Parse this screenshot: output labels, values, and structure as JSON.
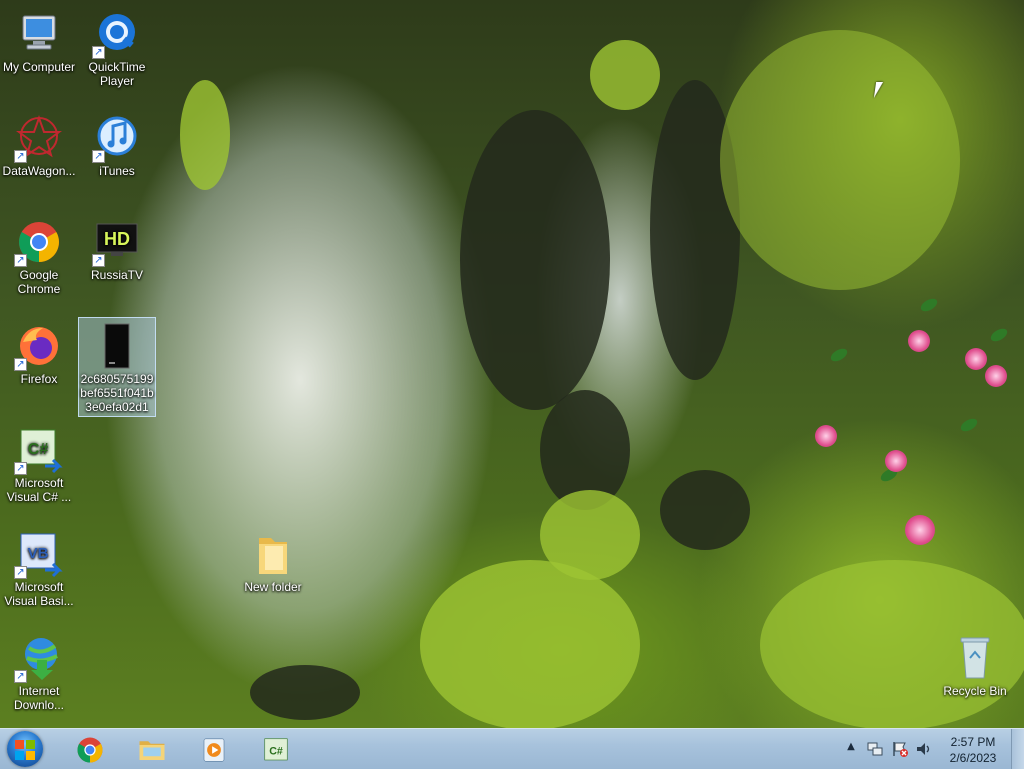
{
  "desktop": {
    "icons": [
      {
        "label": "My Computer",
        "icon": "my-computer-icon",
        "shortcut": false
      },
      {
        "label": "QuickTime Player",
        "icon": "quicktime-icon",
        "shortcut": true
      },
      {
        "label": "DataWagon...",
        "icon": "datawagon-icon",
        "shortcut": true
      },
      {
        "label": "iTunes",
        "icon": "itunes-icon",
        "shortcut": true
      },
      {
        "label": "Google Chrome",
        "icon": "chrome-icon",
        "shortcut": true
      },
      {
        "label": "RussiaTV",
        "icon": "russiatv-icon",
        "shortcut": true,
        "badge": "HD"
      },
      {
        "label": "Firefox",
        "icon": "firefox-icon",
        "shortcut": true
      },
      {
        "label": "2c680575199bef6551f041b3e0efa02d1",
        "icon": "file-icon",
        "shortcut": false,
        "selected": true
      },
      {
        "label": "Microsoft Visual C# ...",
        "icon": "visual-csharp-icon",
        "shortcut": true,
        "badge": "C#"
      },
      {
        "label": "New folder",
        "icon": "folder-icon",
        "shortcut": false
      },
      {
        "label": "Microsoft Visual Basi...",
        "icon": "visual-basic-icon",
        "shortcut": true,
        "badge": "VB"
      },
      {
        "label": "Internet Downlo...",
        "icon": "internet-download-icon",
        "shortcut": true
      },
      {
        "label": "Recycle Bin",
        "icon": "recycle-bin-icon",
        "shortcut": false
      }
    ]
  },
  "taskbar": {
    "pinned": [
      {
        "name": "chrome",
        "icon": "chrome-icon"
      },
      {
        "name": "file-explorer",
        "icon": "file-explorer-icon"
      },
      {
        "name": "media-player",
        "icon": "media-player-icon"
      },
      {
        "name": "visual-csharp",
        "icon": "visual-csharp-icon",
        "badge": "C#"
      }
    ],
    "tray": {
      "time": "2:57 PM",
      "date": "2/6/2023"
    }
  },
  "colors": {
    "taskbar": "#a7c2dc",
    "selection": "#b4d2f0",
    "chrome_red": "#db4437",
    "chrome_green": "#0f9d58",
    "chrome_yellow": "#f4b400",
    "chrome_blue": "#4285f4"
  }
}
